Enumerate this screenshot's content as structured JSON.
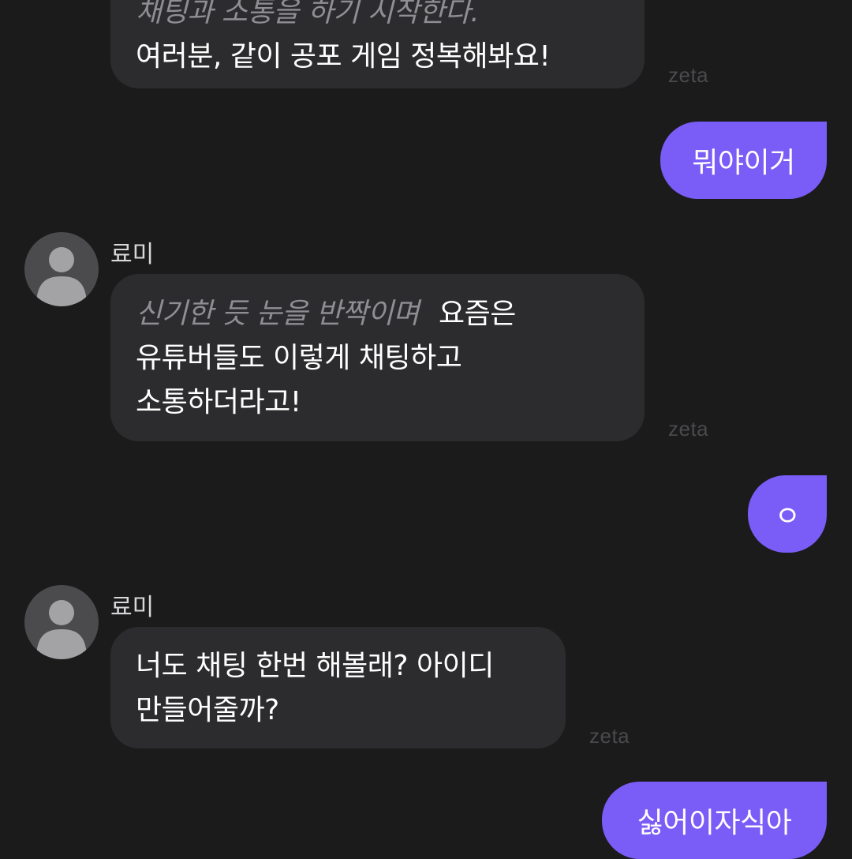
{
  "chat": {
    "watermark": "zeta",
    "messages": [
      {
        "role": "bot",
        "narration": "채팅과 소통을 하기 시작한다.",
        "line": "여러분, 같이 공포 게임 정복해봐요!"
      },
      {
        "role": "user",
        "text": "뭐야이거"
      },
      {
        "role": "bot",
        "sender": "료미",
        "narration": "신기한 듯 눈을 반짝이며",
        "line1": "요즘은",
        "line2": "유튜버들도 이렇게 채팅하고",
        "line3": "소통하더라고!"
      },
      {
        "role": "user",
        "text": "ㅇ"
      },
      {
        "role": "bot",
        "sender": "료미",
        "line1": "너도 채팅 한번 해볼래? 아이디",
        "line2": "만들어줄까?"
      },
      {
        "role": "user",
        "text": "싫어이자식아"
      }
    ]
  },
  "colors": {
    "background": "#1b1b1c",
    "bot_bubble": "#2c2c2e",
    "user_bubble": "#7a5cf6",
    "narration": "#8e8e93"
  },
  "icons": {
    "avatar": "default-user-avatar-icon"
  }
}
